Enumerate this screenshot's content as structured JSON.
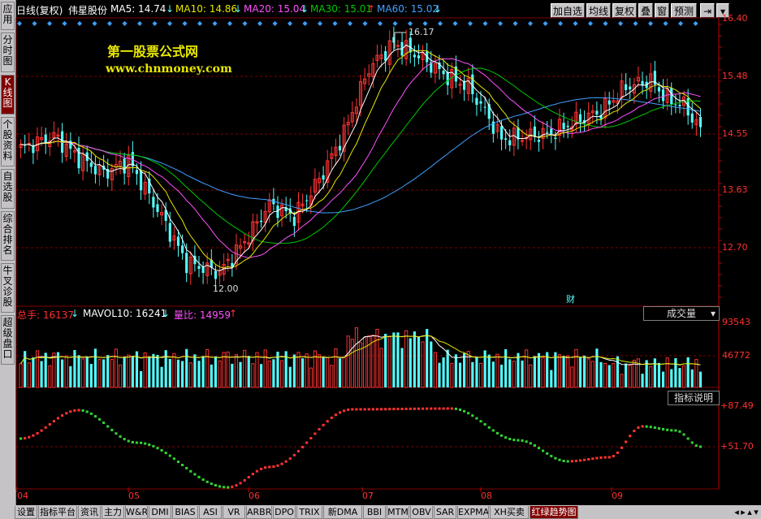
{
  "sidebar": {
    "tabs": [
      {
        "label": "应用",
        "active": false
      },
      {
        "label": "分时图",
        "active": false
      },
      {
        "label": "K线图",
        "active": true
      },
      {
        "label": "个股资料",
        "active": false
      },
      {
        "label": "自选股",
        "active": false
      },
      {
        "label": "综合排名",
        "active": false
      },
      {
        "label": "牛叉诊股",
        "active": false
      },
      {
        "label": "超级盘口",
        "active": false
      }
    ]
  },
  "header": {
    "period": "日线(复权)",
    "stock_name": "伟星股份",
    "ma5": "MA5: 14.74",
    "ma10": "MA10: 14.86",
    "ma20": "MA20: 15.04",
    "ma30": "MA30: 15.01",
    "ma60": "MA60: 15.02",
    "arrow_down": "↓",
    "arrow_up": "↑"
  },
  "toolbar": {
    "buttons": [
      "加自选",
      "均线",
      "复权",
      "叠",
      "窗",
      "预测"
    ],
    "pin_icon": "⇥",
    "menu_icon": "▾"
  },
  "watermark": {
    "line1": "第一股票公式网",
    "line2": "www.chnmoney.com"
  },
  "price_axis": {
    "labels": [
      "16.40",
      "15.48",
      "14.55",
      "13.63",
      "12.70"
    ]
  },
  "annotations": {
    "high": "16.17",
    "low": "12.00",
    "event": "财"
  },
  "volume": {
    "total_label": "总手: 16137",
    "mavol_label": "MAVOL10: 16241",
    "ratio_label": "量比: 14959",
    "dropdown": "成交量",
    "axis": [
      "93543",
      "46772"
    ]
  },
  "indicator": {
    "explain_button": "指标说明",
    "axis": [
      "+87.49",
      "+51.70"
    ]
  },
  "x_axis": {
    "labels": [
      "04",
      "05",
      "06",
      "07",
      "08",
      "09"
    ]
  },
  "bottom_tabs": {
    "tabs": [
      "设置",
      "指标平台",
      "资讯",
      "主力",
      "W&R",
      "DMI",
      "BIAS",
      "ASI",
      "VR",
      "ARBR",
      "DPO",
      "TRIX",
      "新DMA",
      "BBI",
      "MTM",
      "OBV",
      "SAR",
      "EXPMA",
      "XH买卖",
      "红绿趋势图"
    ],
    "active": "红绿趋势图",
    "nav_icons": [
      "◂",
      "▸",
      "▴",
      "▾"
    ]
  },
  "colors": {
    "up": "#ff3232",
    "down": "#54ffff",
    "ma5": "#ffffff",
    "ma10": "#e6e600",
    "ma20": "#ff50ff",
    "ma30": "#00c800",
    "ma60": "#40a0ff",
    "grid": "#800000",
    "axis_text": "#ff3030"
  }
}
